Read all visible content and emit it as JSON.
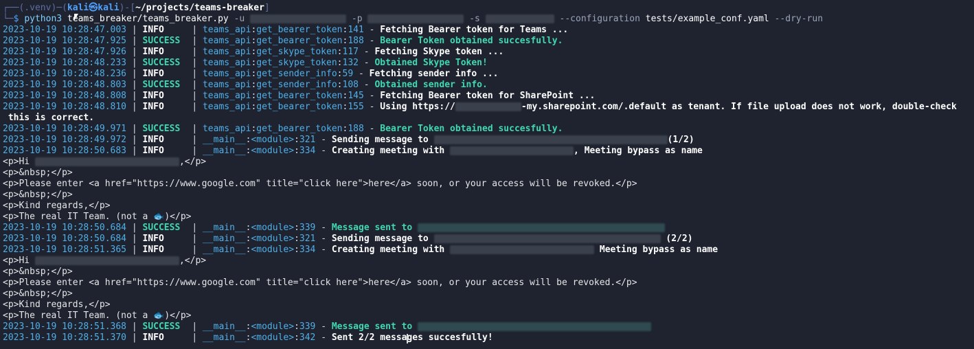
{
  "prompt": {
    "top_left": "┌──",
    "venv": "(.venv)",
    "dash": "─",
    "open": "(",
    "user": "kali",
    "at": "㉿",
    "host": "kali",
    "close": ")",
    "dash2": "-[",
    "cwd": "~/projects/teams-breaker",
    "cwd_close": "]",
    "bottom_left": "└─",
    "dollar": "$ "
  },
  "command": {
    "interpreter": "python3",
    "script": "teams_breaker/teams_breaker.py",
    "flag_u": "-u",
    "flag_p": "-p",
    "flag_s": "-s",
    "flag_conf": "--configuration",
    "conf_file": "tests/example_conf.yaml",
    "flag_dry": "--dry-run"
  },
  "logs1": [
    {
      "ts": "2023-10-19 10:28:47.003",
      "lvl": "INFO",
      "mod": "teams_api",
      "fn": "get_bearer_token",
      "ln": "141",
      "msg": "Fetching Bearer token for Teams ..."
    },
    {
      "ts": "2023-10-19 10:28:47.925",
      "lvl": "SUCCESS",
      "mod": "teams_api",
      "fn": "get_bearer_token",
      "ln": "188",
      "msg": "Bearer Token obtained succesfully."
    },
    {
      "ts": "2023-10-19 10:28:47.926",
      "lvl": "INFO",
      "mod": "teams_api",
      "fn": "get_skype_token",
      "ln": "117",
      "msg": "Fetching Skype token ..."
    },
    {
      "ts": "2023-10-19 10:28:48.233",
      "lvl": "SUCCESS",
      "mod": "teams_api",
      "fn": "get_skype_token",
      "ln": "132",
      "msg": "Obtained Skype Token!"
    },
    {
      "ts": "2023-10-19 10:28:48.236",
      "lvl": "INFO",
      "mod": "teams_api",
      "fn": "get_sender_info",
      "ln": "59",
      "msg": "Fetching sender info ..."
    },
    {
      "ts": "2023-10-19 10:28:48.803",
      "lvl": "SUCCESS",
      "mod": "teams_api",
      "fn": "get_sender_info",
      "ln": "108",
      "msg": "Obtained sender info."
    },
    {
      "ts": "2023-10-19 10:28:48.808",
      "lvl": "INFO",
      "mod": "teams_api",
      "fn": "get_bearer_token",
      "ln": "145",
      "msg": "Fetching Bearer token for SharePoint ..."
    }
  ],
  "tenant_line": {
    "ts": "2023-10-19 10:28:48.810",
    "lvl": "INFO",
    "mod": "teams_api",
    "fn": "get_bearer_token",
    "ln": "155",
    "msg_a": "Using https://",
    "msg_b": "-my.sharepoint.com/.default as tenant. If file upload does not work, double-check",
    "msg_wrap": " this is correct."
  },
  "logs2": [
    {
      "ts": "2023-10-19 10:28:49.971",
      "lvl": "SUCCESS",
      "mod": "teams_api",
      "fn": "get_bearer_token",
      "ln": "188",
      "msg": "Bearer Token obtained succesfully."
    }
  ],
  "round1": {
    "send": {
      "ts": "2023-10-19 10:28:49.972",
      "lvl": "INFO",
      "mod": "__main__",
      "fn": "<module>",
      "ln": "321",
      "msg": "Sending message to ",
      "suffix": "(1/2)"
    },
    "meet": {
      "ts": "2023-10-19 10:28:50.683",
      "lvl": "INFO",
      "mod": "__main__",
      "fn": "<module>",
      "ln": "334",
      "msg": "Creating meeting with ",
      "suffix": ", Meeting bypass as name"
    },
    "sent": {
      "ts": "2023-10-19 10:28:50.684",
      "lvl": "SUCCESS",
      "mod": "__main__",
      "fn": "<module>",
      "ln": "339",
      "msg": "Message sent to "
    }
  },
  "round2": {
    "send": {
      "ts": "2023-10-19 10:28:50.684",
      "lvl": "INFO",
      "mod": "__main__",
      "fn": "<module>",
      "ln": "321",
      "msg": "Sending message to ",
      "suffix": " (2/2)"
    },
    "meet": {
      "ts": "2023-10-19 10:28:51.365",
      "lvl": "INFO",
      "mod": "__main__",
      "fn": "<module>",
      "ln": "334",
      "msg": "Creating meeting with ",
      "suffix": " Meeting bypass as name"
    },
    "sent": {
      "ts": "2023-10-19 10:28:51.368",
      "lvl": "SUCCESS",
      "mod": "__main__",
      "fn": "<module>",
      "ln": "339",
      "msg": "Message sent to "
    }
  },
  "final": {
    "ts": "2023-10-19 10:28:51.370",
    "lvl": "INFO",
    "mod": "__main__",
    "fn": "<module>",
    "ln": "342",
    "msg": "Sent 2/2 messages succesfully!"
  },
  "body": {
    "hi_open": "<p>Hi ",
    "hi_close": ",</p>",
    "nbsp": "<p>&nbsp;</p>",
    "please": "<p>Please enter <a href=\"https://www.google.com\" title=\"click here\">here</a> soon, or your access will be revoked.</p>",
    "regards": "<p>Kind regards,</p>",
    "sig_a": "<p>The real IT Team. (not a ",
    "fish": "🐟",
    "sig_b": ")</p>"
  },
  "sep": " | ",
  "colon": ":",
  "dash_sep": " - "
}
